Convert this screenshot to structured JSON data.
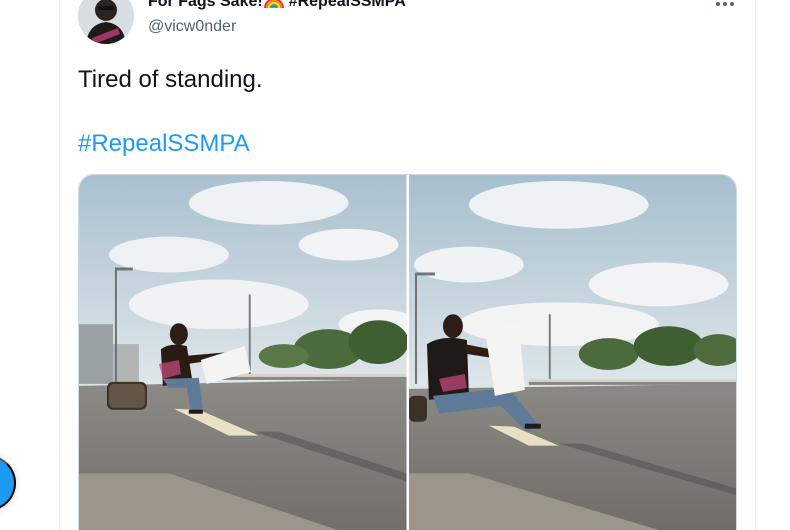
{
  "tweet": {
    "display_name": "For Fags Sake!",
    "name_hashtag": "#RepealSSMPA",
    "handle": "@vicw0nder",
    "text": "Tired of standing.",
    "hashtag": "#RepealSSMPA",
    "avatar_icon": "avatar-photo",
    "emoji_icon": "rainbow-icon",
    "more_icon": "more-horizontal-icon"
  },
  "media": {
    "photos": [
      {
        "name": "media-photo-1",
        "subject": "protester-sitting-holding-sign"
      },
      {
        "name": "media-photo-2",
        "subject": "protester-sitting-holding-sign"
      }
    ]
  },
  "colors": {
    "link": "#1d9bf0",
    "text": "#0f1419",
    "secondary": "#536471",
    "border": "#eff3f4"
  }
}
